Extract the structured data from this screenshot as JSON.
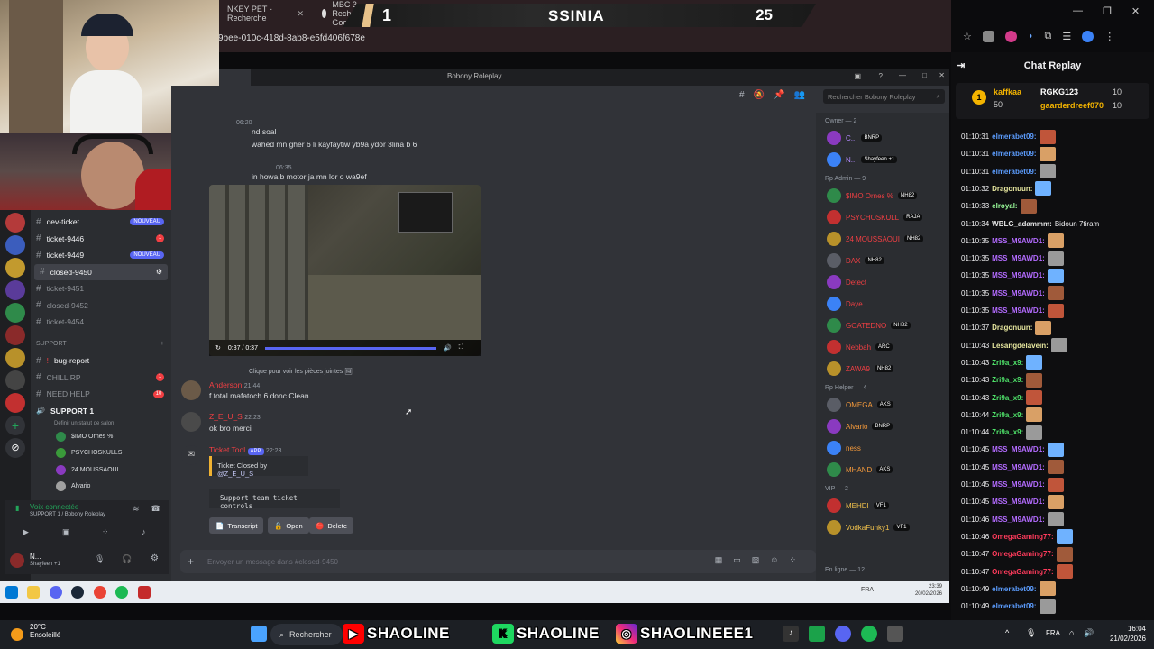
{
  "browser": {
    "tabs": [
      {
        "label": "NKEY PET - Recherche"
      },
      {
        "label": "MBC 3 - Recherche Google"
      }
    ],
    "url": "9bee-010c-418d-8ab8-e5fd406f678e"
  },
  "scoreboard": {
    "left_score": "1",
    "title": "SSINIA",
    "right_score": "25"
  },
  "discord": {
    "window_title": "Bobony Roleplay",
    "search_placeholder": "Rechercher Bobony Roleplay",
    "channels": [
      {
        "name": "dev-ticket",
        "badge": "NOUVEAU"
      },
      {
        "name": "ticket-9446",
        "badge": "1"
      },
      {
        "name": "ticket-9449",
        "badge": "NOUVEAU"
      },
      {
        "name": "closed-9450",
        "badge": ""
      },
      {
        "name": "ticket-9451",
        "badge": ""
      },
      {
        "name": "closed-9452",
        "badge": ""
      },
      {
        "name": "ticket-9454",
        "badge": ""
      }
    ],
    "support_header": "SUPPORT",
    "support_channels": [
      {
        "name": "bug-report",
        "badge": ""
      },
      {
        "name": "CHILL RP",
        "badge": "1"
      },
      {
        "name": "NEED HELP",
        "badge": "10"
      }
    ],
    "voice_channel": "SUPPORT 1",
    "voice_channel_sub": "Définir un statut de salon",
    "voice_users": [
      "$IMO Ornes %",
      "PSYCHOSKULLS",
      "24 MOUSSAOUI",
      "Alvario"
    ],
    "voice_connected": "Voix connectée",
    "voice_connected_sub": "SUPPORT 1 / Bobony Roleplay",
    "user_name": "N...",
    "user_status": "Shayfeen +1",
    "messages": [
      {
        "text": "nd soal",
        "time": "06:20"
      },
      {
        "text": "wahed mn gher 6 li kayfaytiw yb9a ydor 3lina b 6"
      },
      {
        "text": "in howa b motor ja mn lor o wa9ef",
        "time": "06:35"
      }
    ],
    "video_time": "0:37 / 0:37",
    "video_progress": 1.0,
    "attachment_note": "Clique pour voir les pièces jointes",
    "msg_anderson": {
      "author": "Anderson",
      "time": "21:44",
      "text": "f total mafatoch 6 donc Clean"
    },
    "msg_zeus": {
      "author": "Z_E_U_S",
      "time": "22:23",
      "text": "ok bro merci"
    },
    "ticket_tool": {
      "author": "Ticket Tool",
      "app": "APP",
      "time": "22:23",
      "closed_by": "Ticket Closed by",
      "mention": "@Z_E_U_S",
      "controls": "Support team ticket controls"
    },
    "buttons": {
      "transcript": "Transcript",
      "open": "Open",
      "delete": "Delete"
    },
    "input_placeholder": "Envoyer un message dans #closed-9450",
    "member_groups": [
      {
        "label": "Owner — 2",
        "members": [
          {
            "name": "C...",
            "tag": "BNRP"
          },
          {
            "name": "N...",
            "tag": "Shayfeen +1"
          }
        ]
      },
      {
        "label": "Rp Admin — 9",
        "members": [
          {
            "name": "$IMO Ornes %",
            "tag": "NH82"
          },
          {
            "name": "PSYCHOSKULL",
            "tag": "RAJA"
          },
          {
            "name": "24 MOUSSAOUI",
            "tag": "NH82"
          },
          {
            "name": "DAX",
            "tag": "NH82"
          },
          {
            "name": "Detect",
            "tag": ""
          },
          {
            "name": "Daye",
            "tag": ""
          },
          {
            "name": "GOATEDNO",
            "tag": "NH82"
          },
          {
            "name": "Nebbah",
            "tag": "ARC"
          },
          {
            "name": "ZAWA9",
            "tag": "NH82"
          }
        ]
      },
      {
        "label": "Rp Helper — 4",
        "members": [
          {
            "name": "OMEGA",
            "tag": "AKS"
          },
          {
            "name": "Alvario",
            "tag": "BNRP"
          },
          {
            "name": "ness",
            "tag": ""
          },
          {
            "name": "MHAND",
            "tag": "AKS"
          }
        ]
      },
      {
        "label": "VIP — 2",
        "members": [
          {
            "name": "MEHDI",
            "tag": "VF1"
          },
          {
            "name": "VodkaFunky1",
            "tag": "VF1"
          }
        ]
      }
    ],
    "online_label": "En ligne — 12"
  },
  "inner_taskbar": {
    "lang": "FRA",
    "time": "23:39",
    "date": "20/02/2026"
  },
  "chat_replay": {
    "title": "Chat Replay",
    "leaders": [
      {
        "rank": "1",
        "name": "kaffkaa",
        "points": "50"
      },
      {
        "name": "RGKG123",
        "points": "10"
      },
      {
        "name": "gaarderdreef070",
        "points": "10"
      }
    ],
    "lines": [
      {
        "ts": "01:10:31",
        "user": "elmerabet09:",
        "color": "#5c9dff",
        "text": ""
      },
      {
        "ts": "01:10:31",
        "user": "elmerabet09:",
        "color": "#5c9dff",
        "text": ""
      },
      {
        "ts": "01:10:31",
        "user": "elmerabet09:",
        "color": "#5c9dff",
        "text": ""
      },
      {
        "ts": "01:10:32",
        "user": "Dragonuun:",
        "color": "#e9e9a0",
        "text": ""
      },
      {
        "ts": "01:10:33",
        "user": "elroyal:",
        "color": "#9cff9c",
        "text": ""
      },
      {
        "ts": "01:10:34",
        "user": "WBLG_adammm:",
        "color": "#e6e6e6",
        "text": "Bidoun 7tiram"
      },
      {
        "ts": "01:10:35",
        "user": "MSS_M9AWD1:",
        "color": "#b36bff",
        "text": ""
      },
      {
        "ts": "01:10:35",
        "user": "MSS_M9AWD1:",
        "color": "#b36bff",
        "text": ""
      },
      {
        "ts": "01:10:35",
        "user": "MSS_M9AWD1:",
        "color": "#b36bff",
        "text": ""
      },
      {
        "ts": "01:10:35",
        "user": "MSS_M9AWD1:",
        "color": "#b36bff",
        "text": ""
      },
      {
        "ts": "01:10:35",
        "user": "MSS_M9AWD1:",
        "color": "#b36bff",
        "text": ""
      },
      {
        "ts": "01:10:37",
        "user": "Dragonuun:",
        "color": "#e9e9a0",
        "text": ""
      },
      {
        "ts": "01:10:43",
        "user": "Lesangdelavein:",
        "color": "#e9e9a0",
        "text": ""
      },
      {
        "ts": "01:10:43",
        "user": "Zri9a_x9:",
        "color": "#4fe36a",
        "text": ""
      },
      {
        "ts": "01:10:43",
        "user": "Zri9a_x9:",
        "color": "#4fe36a",
        "text": ""
      },
      {
        "ts": "01:10:43",
        "user": "Zri9a_x9:",
        "color": "#4fe36a",
        "text": ""
      },
      {
        "ts": "01:10:44",
        "user": "Zri9a_x9:",
        "color": "#4fe36a",
        "text": ""
      },
      {
        "ts": "01:10:44",
        "user": "Zri9a_x9:",
        "color": "#4fe36a",
        "text": ""
      },
      {
        "ts": "01:10:45",
        "user": "MSS_M9AWD1:",
        "color": "#b36bff",
        "text": ""
      },
      {
        "ts": "01:10:45",
        "user": "MSS_M9AWD1:",
        "color": "#b36bff",
        "text": ""
      },
      {
        "ts": "01:10:45",
        "user": "MSS_M9AWD1:",
        "color": "#b36bff",
        "text": ""
      },
      {
        "ts": "01:10:45",
        "user": "MSS_M9AWD1:",
        "color": "#b36bff",
        "text": ""
      },
      {
        "ts": "01:10:46",
        "user": "MSS_M9AWD1:",
        "color": "#b36bff",
        "text": ""
      },
      {
        "ts": "01:10:46",
        "user": "OmegaGaming77:",
        "color": "#ff3b5c",
        "text": ""
      },
      {
        "ts": "01:10:47",
        "user": "OmegaGaming77:",
        "color": "#ff3b5c",
        "text": ""
      },
      {
        "ts": "01:10:47",
        "user": "OmegaGaming77:",
        "color": "#ff3b5c",
        "text": ""
      },
      {
        "ts": "01:10:49",
        "user": "elmerabet09:",
        "color": "#5c9dff",
        "text": ""
      },
      {
        "ts": "01:10:49",
        "user": "elmerabet09:",
        "color": "#5c9dff",
        "text": ""
      }
    ]
  },
  "taskbar": {
    "temp": "20°C",
    "weather": "Ensoleillé",
    "search": "Rechercher",
    "socials": [
      "SHAOLINE",
      "SHAOLINE",
      "SHAOLINEEE1"
    ],
    "lang": "FRA",
    "time": "16:04",
    "date": "21/02/2026"
  }
}
